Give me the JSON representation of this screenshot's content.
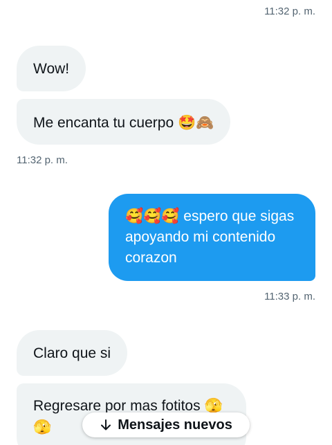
{
  "timestamps": {
    "top": "11:32 p. m.",
    "left_after_group": "11:32 p. m.",
    "after_outgoing": "11:33 p. m."
  },
  "messages": {
    "wow": "Wow!",
    "encanta": {
      "text": "Me encanta tu cuerpo ",
      "emoji": "🤩🙈"
    },
    "outgoing": {
      "emoji": "🥰🥰🥰",
      "text": " espero que sigas apoyando mi contenido corazon"
    },
    "claro": "Claro que si",
    "regresare": {
      "text": "Regresare por mas fotitos ",
      "emoji": "🫣",
      "emoji2": "🫣"
    }
  },
  "new_messages_pill": {
    "label": "Mensajes nuevos",
    "icon": "arrow-down-icon"
  },
  "colors": {
    "incoming_bubble": "#eff3f4",
    "outgoing_bubble": "#1d9bf0",
    "timestamp": "#536471"
  }
}
